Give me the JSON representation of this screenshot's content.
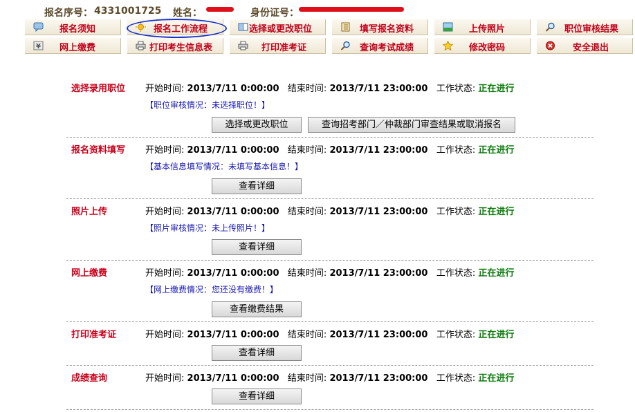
{
  "header": {
    "reg_no_label": "报名序号：",
    "reg_no_value": "4331001725",
    "name_label": "姓名：",
    "id_label": "身份证号："
  },
  "nav": [
    {
      "label": "报名须知",
      "icon": "message-icon"
    },
    {
      "label": "报名工作流程",
      "icon": "sun-icon"
    },
    {
      "label": "选择或更改职位",
      "icon": "book-icon"
    },
    {
      "label": "填写报名资料",
      "icon": "notebook-icon"
    },
    {
      "label": "上传照片",
      "icon": "picture-icon"
    },
    {
      "label": "职位审核结果",
      "icon": "magnifier-icon"
    },
    {
      "label": "网上缴费",
      "icon": "yen-icon"
    },
    {
      "label": "打印考生信息表",
      "icon": "printer-icon"
    },
    {
      "label": "打印准考证",
      "icon": "printer-icon"
    },
    {
      "label": "查询考试成绩",
      "icon": "magnifier-icon"
    },
    {
      "label": "修改密码",
      "icon": "star-icon"
    },
    {
      "label": "安全退出",
      "icon": "exit-icon"
    }
  ],
  "common": {
    "start_label": "开始时间:",
    "start_value": "2013/7/11 0:00:00",
    "end_label": "结束时间:",
    "end_value": "2013/7/11 23:00:00",
    "state_label": "工作状态:",
    "state_value": "正在进行"
  },
  "rows": [
    {
      "title": "选择录用职位",
      "note": "【职位审核情况：未选择职位！】",
      "buttons": [
        "选择或更改职位",
        "查询招考部门／仲裁部门审查结果或取消报名"
      ]
    },
    {
      "title": "报名资料填写",
      "note": "【基本信息填写情况：未填写基本信息！】",
      "buttons": [
        "查看详细"
      ]
    },
    {
      "title": "照片上传",
      "note": "【照片审核情况：未上传照片！】",
      "buttons": [
        "查看详细"
      ]
    },
    {
      "title": "网上缴费",
      "note": "【网上缴费情况：您还没有缴费！】",
      "buttons": [
        "查看缴费结果"
      ]
    },
    {
      "title": "打印准考证",
      "note": "",
      "buttons": [
        "查看详细"
      ]
    },
    {
      "title": "成绩查询",
      "note": "",
      "buttons": [
        "查看详细"
      ]
    }
  ],
  "colors": {
    "accent_red": "#c8001a",
    "status_green": "#0b7a0b",
    "note_blue": "#1818b0",
    "highlight_ellipse": "#1a33c9"
  }
}
